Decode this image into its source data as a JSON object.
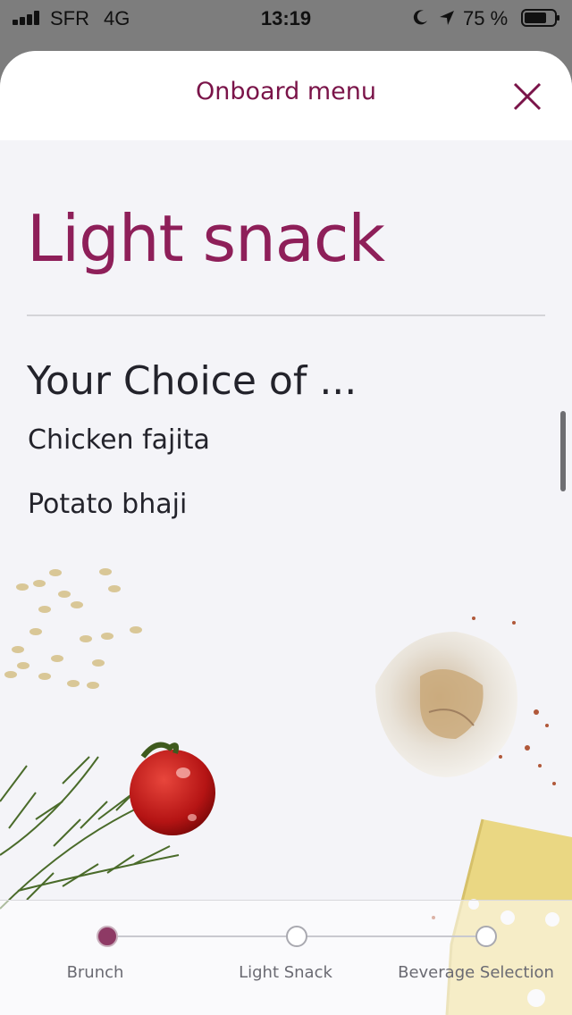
{
  "status_bar": {
    "carrier": "SFR",
    "network": "4G",
    "time": "13:19",
    "battery_percent": "75 %",
    "icons": [
      "signal-icon",
      "moon-icon",
      "location-icon",
      "battery-icon"
    ]
  },
  "header": {
    "title": "Onboard menu",
    "close_icon": "close-icon"
  },
  "menu": {
    "section_title": "Light snack",
    "choice_heading": "Your Choice of ...",
    "items": [
      "Chicken fajita",
      "Potato bhaji"
    ]
  },
  "steps": [
    {
      "label": "Brunch",
      "active": true
    },
    {
      "label": "Light Snack",
      "active": false
    },
    {
      "label": "Beverage Selection",
      "active": false
    }
  ],
  "colors": {
    "brand": "#7a1449",
    "title": "#8e1f59",
    "active_step": "#8e3a65"
  }
}
